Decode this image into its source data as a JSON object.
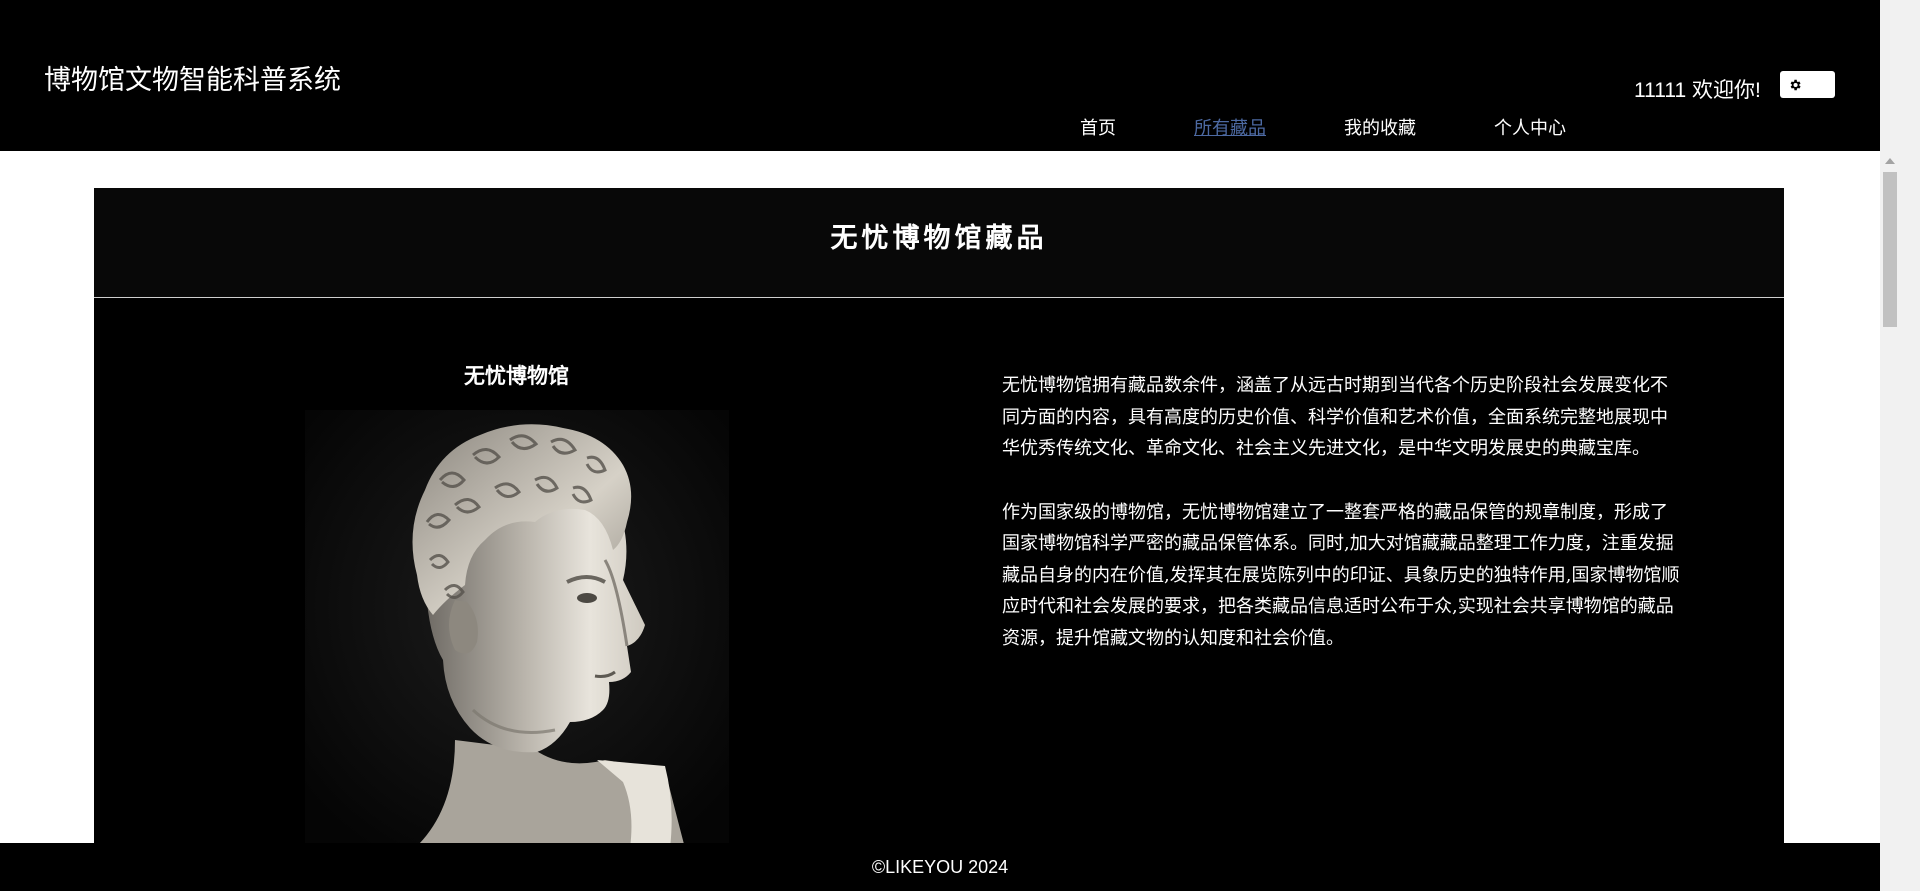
{
  "header": {
    "brand": "博物馆文物智能科普系统",
    "welcome": "11111 欢迎你!",
    "settings_icon": "gear-icon"
  },
  "nav": {
    "items": [
      {
        "label": "首页",
        "active": false
      },
      {
        "label": "所有藏品",
        "active": true
      },
      {
        "label": "我的收藏",
        "active": false
      },
      {
        "label": "个人中心",
        "active": false
      }
    ]
  },
  "main": {
    "panel_title": "无忧博物馆藏品",
    "museum_name": "无忧博物馆",
    "paragraphs": [
      "无忧博物馆拥有藏品数余件，涵盖了从远古时期到当代各个历史阶段社会发展变化不同方面的内容，具有高度的历史价值、科学价值和艺术价值，全面系统完整地展现中华优秀传统文化、革命文化、社会主义先进文化，是中华文明发展史的典藏宝库。",
      "作为国家级的博物馆，无忧博物馆建立了一整套严格的藏品保管的规章制度，形成了国家博物馆科学严密的藏品保管体系。同时,加大对馆藏藏品整理工作力度，注重发掘藏品自身的内在价值,发挥其在展览陈列中的印证、具象历史的独特作用,国家博物馆顺应时代和社会发展的要求，把各类藏品信息适时公布于众,实现社会共享博物馆的藏品资源，提升馆藏文物的认知度和社会价值。"
    ]
  },
  "footer": {
    "copyright": "©LIKEYOU 2024"
  },
  "colors": {
    "header_bg": "#000000",
    "active_nav": "#4d6aa3",
    "page_bg": "#ffffff"
  }
}
